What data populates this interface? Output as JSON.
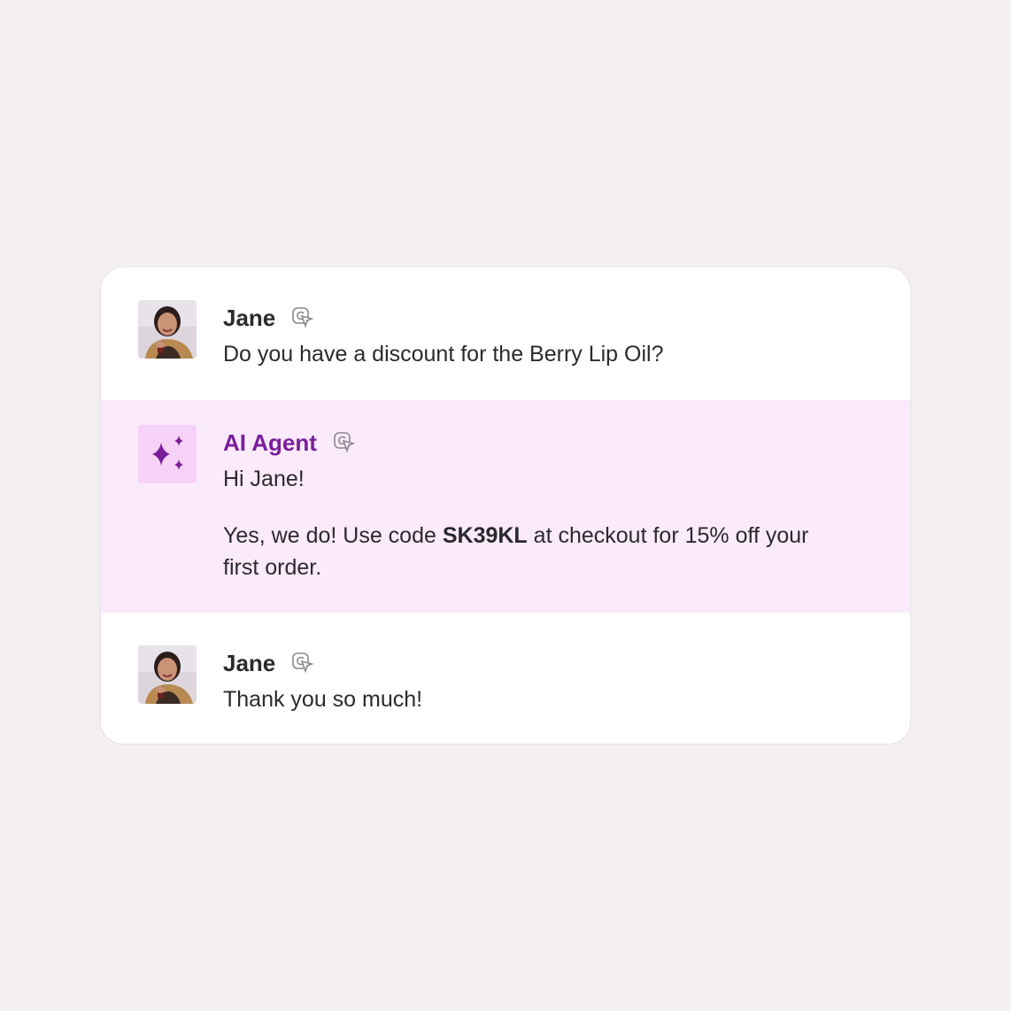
{
  "messages": [
    {
      "sender": "Jane",
      "text": "Do you have a discount for the Berry Lip Oil?",
      "avatar": "jane-avatar-photo",
      "badge_icon": "channel-icon"
    },
    {
      "sender": "AI Agent",
      "greeting": "Hi Jane!",
      "reply_prefix": "Yes, we do! Use code ",
      "code": "SK39KL",
      "reply_suffix": " at checkout for 15% off your first order.",
      "avatar": "sparkle-icon",
      "badge_icon": "channel-icon"
    },
    {
      "sender": "Jane",
      "text": "Thank you so much!",
      "avatar": "jane-avatar-photo",
      "badge_icon": "channel-icon"
    }
  ],
  "colors": {
    "background": "#f4f0f1",
    "card": "#ffffff",
    "ai_highlight": "#fbeafc",
    "ai_accent": "#7a1e9a",
    "text": "#2b2a2e"
  }
}
